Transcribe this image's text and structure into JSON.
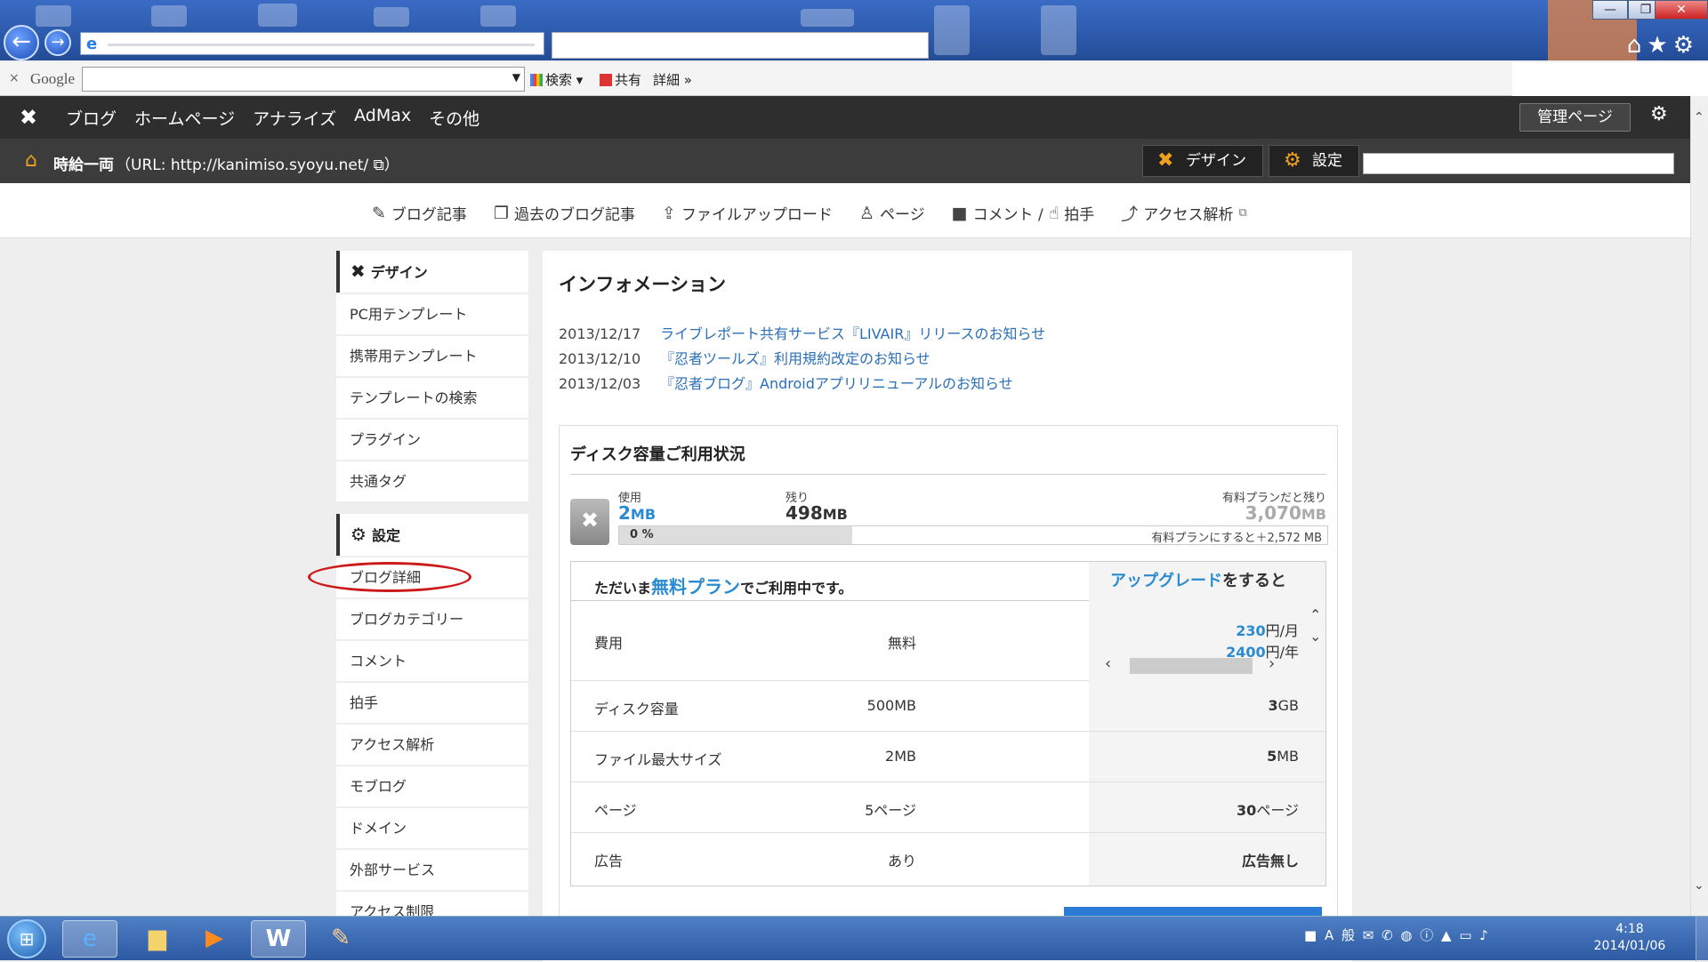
{
  "browser": {
    "google_label": "Google",
    "search_btn": "検索",
    "share_btn": "共有",
    "detail_btn": "詳細 »",
    "close_x": "×"
  },
  "ninja": {
    "top_nav": [
      "ブログ",
      "ホームページ",
      "アナライズ",
      "AdMax",
      "その他"
    ],
    "admin_page": "管理ページ",
    "blog_name": "時給一両",
    "blog_url": "（URL: http://kanimiso.syoyu.net/",
    "blog_url_end": "）",
    "design_btn": "デザイン",
    "settings_btn": "設定"
  },
  "subnav": [
    {
      "label": "ブログ記事",
      "icon": "✎"
    },
    {
      "label": "過去のブログ記事",
      "icon": "❐"
    },
    {
      "label": "ファイルアップロード",
      "icon": "⇪"
    },
    {
      "label": "ページ",
      "icon": "♙"
    },
    {
      "label": "コメント / ",
      "icon": "■"
    },
    {
      "label": "拍手",
      "icon": "☝"
    },
    {
      "label": "アクセス解析",
      "icon": "⤴"
    }
  ],
  "sidebar": {
    "design_header": "デザイン",
    "design_items": [
      "PC用テンプレート",
      "携帯用テンプレート",
      "テンプレートの検索",
      "プラグイン",
      "共通タグ"
    ],
    "settings_header": "設定",
    "settings_items": [
      "ブログ詳細",
      "ブログカテゴリー",
      "コメント",
      "拍手",
      "アクセス解析",
      "モブログ",
      "ドメイン",
      "外部サービス",
      "アクセス制限"
    ]
  },
  "info": {
    "title": "インフォメーション",
    "news": [
      {
        "date": "2013/12/17",
        "text": "ライブレポート共有サービス『LIVAIR』リリースのお知らせ"
      },
      {
        "date": "2013/12/10",
        "text": "『忍者ツールズ』利用規約改定のお知らせ"
      },
      {
        "date": "2013/12/03",
        "text": "『忍者ブログ』Androidアプリリニューアルのお知らせ"
      }
    ]
  },
  "disk": {
    "title": "ディスク容量ご利用状況",
    "used_label": "使用",
    "used_value": "2",
    "used_unit": "MB",
    "remain_label": "残り",
    "remain_value": "498",
    "remain_unit": "MB",
    "paid_label": "有料プランだと残り",
    "paid_value": "3,070",
    "paid_unit": "MB",
    "usage_fraction": 0.0,
    "percent_text": "0 %",
    "paid_add_text": "有料プランにすると＋2,572 MB"
  },
  "plan": {
    "header_pre": "ただいま",
    "header_free": "無料プラン",
    "header_post": "でご利用中です。",
    "upgrade_link": "アップグレード",
    "upgrade_post": "をすると",
    "rows": [
      {
        "key": "費用",
        "free": "無料"
      },
      {
        "key": "ディスク容量",
        "free": "500MB",
        "paid_num": "3",
        "paid_unit": "GB"
      },
      {
        "key": "ファイル最大サイズ",
        "free": "2MB",
        "paid_num": "5",
        "paid_unit": "MB"
      },
      {
        "key": "ページ",
        "free": "5ページ",
        "paid_num": "30",
        "paid_unit": "ページ"
      },
      {
        "key": "広告",
        "free": "あり",
        "paid_text": "広告無し"
      }
    ],
    "price_month_num": "230",
    "price_month_unit": "円/月",
    "price_year_num": "2400",
    "price_year_unit": "円/年"
  },
  "taskbar": {
    "time": "4:18",
    "date": "2014/01/06",
    "tray_text": "A 般"
  },
  "colors": {
    "accent_blue": "#2a8bd0",
    "link_blue": "#2a6fb8",
    "highlight_red": "#cc1a1a",
    "dark_bar": "#2e2e2e"
  }
}
